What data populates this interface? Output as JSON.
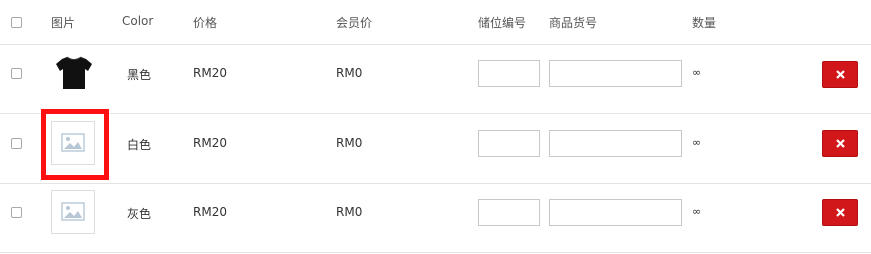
{
  "header": {
    "image": "图片",
    "color": "Color",
    "price": "价格",
    "member_price": "会员价",
    "location_code": "储位编号",
    "product_code": "商品货号",
    "quantity": "数量"
  },
  "rows": [
    {
      "image": "tshirt-black-photo",
      "color": "黑色",
      "price": "RM20",
      "member_price": "RM0",
      "location_code": "",
      "product_code": "",
      "quantity": "∞",
      "selected": false
    },
    {
      "image": "image-placeholder-icon",
      "color": "白色",
      "price": "RM20",
      "member_price": "RM0",
      "location_code": "",
      "product_code": "",
      "quantity": "∞",
      "selected": false,
      "highlighted": true
    },
    {
      "image": "image-placeholder-icon",
      "color": "灰色",
      "price": "RM20",
      "member_price": "RM0",
      "location_code": "",
      "product_code": "",
      "quantity": "∞",
      "selected": false
    }
  ],
  "colors": {
    "delete_button": "#d2171a",
    "highlight": "#ff1010",
    "border": "#e4e4e4"
  },
  "icons": {
    "delete": "close-icon",
    "quantity": "infinity"
  }
}
